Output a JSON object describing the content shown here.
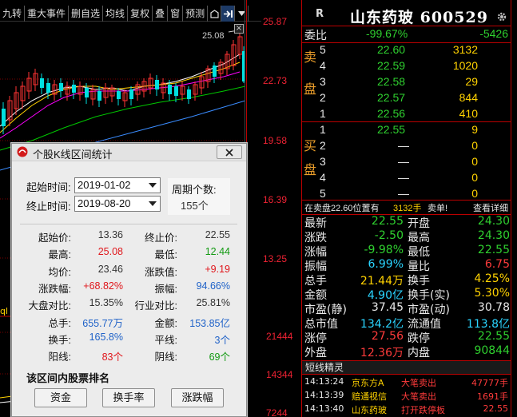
{
  "toolbar": {
    "buttons": [
      "九转",
      "重大事件",
      "删自选",
      "均线",
      "复权",
      "叠",
      "窗",
      "预测"
    ],
    "icons": [
      "home-icon",
      "expand-icon",
      "dropdown-icon"
    ]
  },
  "chart": {
    "price_labels": [
      "25.87",
      "22.73",
      "19.58",
      "16.39",
      "13.25"
    ],
    "volume_labels": [
      "21444",
      "14344",
      "7244"
    ],
    "high_marker": "25.08",
    "colors": {
      "up": "#ff3333",
      "down": "#00e0e0",
      "ma1": "#ffffff",
      "ma2": "#ffd200",
      "ma3": "#ff00ff",
      "ma4": "#00c800",
      "ma5": "#3a8cff"
    }
  },
  "quote": {
    "badge": "R",
    "name": "山东药玻 600529",
    "weibi_label": "委比",
    "weibi_pct": "-99.67%",
    "weicha": "-5426",
    "sell_label": "卖盘",
    "buy_label": "买盘",
    "sell": [
      {
        "lv": "5",
        "price": "22.60",
        "vol": "3132"
      },
      {
        "lv": "4",
        "price": "22.59",
        "vol": "1020"
      },
      {
        "lv": "3",
        "price": "22.58",
        "vol": "29"
      },
      {
        "lv": "2",
        "price": "22.57",
        "vol": "844"
      },
      {
        "lv": "1",
        "price": "22.56",
        "vol": "410"
      }
    ],
    "buy": [
      {
        "lv": "1",
        "price": "22.55",
        "vol": "9"
      },
      {
        "lv": "2",
        "price": "—",
        "vol": "0"
      },
      {
        "lv": "3",
        "price": "—",
        "vol": "0"
      },
      {
        "lv": "4",
        "price": "—",
        "vol": "0"
      },
      {
        "lv": "5",
        "price": "—",
        "vol": "0"
      }
    ],
    "status": {
      "left": "在卖盘22.60位置有",
      "mid": "3132手",
      "tag": "卖单!",
      "link": "查看详细"
    },
    "stats": [
      [
        "最新",
        "22.55",
        "green",
        "开盘",
        "24.30",
        "green"
      ],
      [
        "涨跌",
        "-2.50",
        "green",
        "最高",
        "24.30",
        "green"
      ],
      [
        "涨幅",
        "-9.98%",
        "green",
        "最低",
        "22.55",
        "green"
      ],
      [
        "振幅",
        "6.99%",
        "cyan",
        "量比",
        "6.75",
        "red"
      ],
      [
        "总手",
        "21.44万",
        "yel",
        "换手",
        "4.25%",
        "yel"
      ],
      [
        "金额",
        "4.90亿",
        "cyan",
        "换手(实)",
        "5.30%",
        "yel"
      ],
      [
        "市盈(静)",
        "37.45",
        "white",
        "市盈(动)",
        "30.78",
        "white"
      ],
      [
        "总市值",
        "134.2亿",
        "cyan",
        "流通值",
        "113.8亿",
        "cyan"
      ],
      [
        "涨停",
        "27.56",
        "red",
        "跌停",
        "22.55",
        "green"
      ],
      [
        "外盘",
        "12.36万",
        "red",
        "内盘",
        "90844",
        "green"
      ]
    ],
    "ticks_title": "短线精灵",
    "ticks": [
      {
        "time": "14:13:24",
        "name": "京东方A",
        "event": "大笔卖出",
        "vol": "47777手"
      },
      {
        "time": "14:13:39",
        "name": "赔通视信",
        "event": "大笔卖出",
        "vol": "1691手"
      },
      {
        "time": "14:13:40",
        "name": "山东药玻",
        "event": "打开跌停板",
        "vol": "22.55"
      }
    ]
  },
  "dialog": {
    "title": "个股K线区间统计",
    "start_label": "起始时间:",
    "start_value": "2019-01-02",
    "end_label": "终止时间:",
    "end_value": "2019-08-20",
    "period_label": "周期个数:",
    "period_value": "155个",
    "rows": [
      [
        "起始价:",
        "13.36",
        "dark",
        "终止价:",
        "22.55",
        "dark"
      ],
      [
        "最高:",
        "25.08",
        "red",
        "最低:",
        "12.44",
        "green"
      ],
      [
        "均价:",
        "23.46",
        "dark",
        "涨跌值:",
        "+9.19",
        "red"
      ],
      [
        "涨跌幅:",
        "+68.82%",
        "red",
        "振幅:",
        "94.66%",
        "blue"
      ],
      [
        "大盘对比:",
        "15.35%",
        "dark",
        "行业对比:",
        "25.81%",
        "dark"
      ],
      [
        "总手:",
        "655.77万",
        "blue",
        "金额:",
        "153.85亿",
        "blue"
      ],
      [
        "换手:",
        "165.8%",
        "blue",
        "平线:",
        "3个",
        "blue"
      ],
      [
        "阳线:",
        "83个",
        "red",
        "阴线:",
        "69个",
        "green"
      ]
    ],
    "rank_title": "该区间内股票排名",
    "buttons": [
      "资金",
      "换手率",
      "涨跌幅"
    ]
  }
}
